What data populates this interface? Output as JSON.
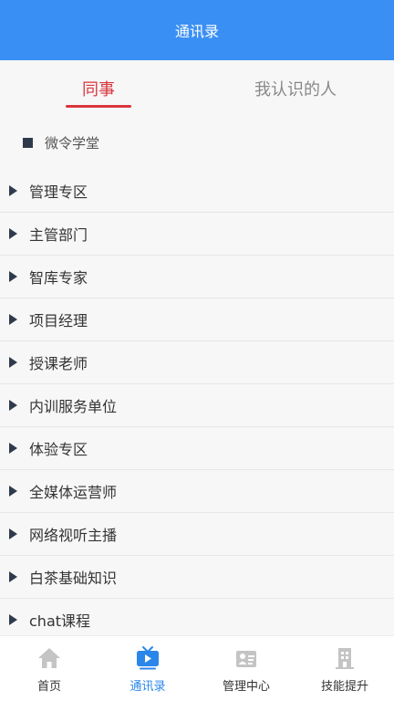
{
  "header": {
    "title": "通讯录"
  },
  "tabs": [
    {
      "label": "同事",
      "active": true
    },
    {
      "label": "我认识的人",
      "active": false
    }
  ],
  "group": {
    "label": "微令学堂"
  },
  "list": {
    "items": [
      {
        "label": "管理专区"
      },
      {
        "label": "主管部门"
      },
      {
        "label": "智库专家"
      },
      {
        "label": "项目经理"
      },
      {
        "label": "授课老师"
      },
      {
        "label": "内训服务单位"
      },
      {
        "label": "体验专区"
      },
      {
        "label": "全媒体运营师"
      },
      {
        "label": "网络视听主播"
      },
      {
        "label": "白茶基础知识"
      },
      {
        "label": "chat课程"
      }
    ]
  },
  "bottom_nav": {
    "items": [
      {
        "label": "首页",
        "icon": "home-icon",
        "active": false
      },
      {
        "label": "通讯录",
        "icon": "tv-icon",
        "active": true
      },
      {
        "label": "管理中心",
        "icon": "id-card-icon",
        "active": false
      },
      {
        "label": "技能提升",
        "icon": "building-icon",
        "active": false
      }
    ]
  },
  "colors": {
    "header_bg": "#3a8ff4",
    "active_tab": "#d9363e",
    "active_nav": "#2a86e8",
    "inactive_icon": "#c4c4c4"
  }
}
